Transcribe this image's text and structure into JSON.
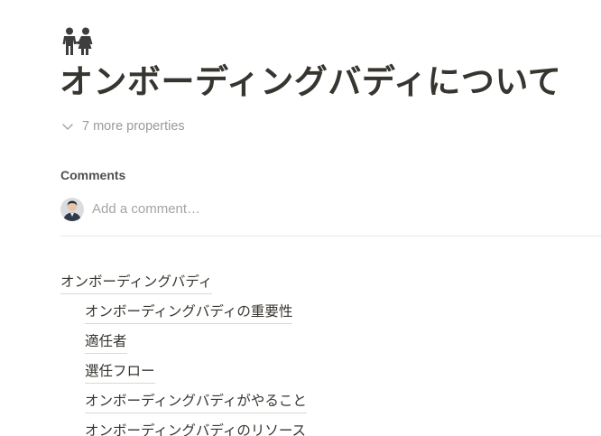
{
  "page": {
    "icon": "people-holding-hands-icon",
    "title": "オンボーディングバディについて"
  },
  "properties": {
    "toggle_label": "7 more properties",
    "icon": "chevron-down-icon"
  },
  "comments": {
    "heading": "Comments",
    "placeholder": "Add a comment…",
    "avatar": "user-avatar"
  },
  "toc": {
    "items": [
      {
        "label": "オンボーディングバディ",
        "level": 1
      },
      {
        "label": "オンボーディングバディの重要性",
        "level": 2
      },
      {
        "label": "適任者",
        "level": 2
      },
      {
        "label": "選任フロー",
        "level": 2
      },
      {
        "label": "オンボーディングバディがやること",
        "level": 2
      },
      {
        "label": "オンボーディングバディのリソース",
        "level": 2
      }
    ]
  },
  "colors": {
    "text": "#37352f",
    "muted": "#9b9a97",
    "divider": "#e9e9e7"
  }
}
